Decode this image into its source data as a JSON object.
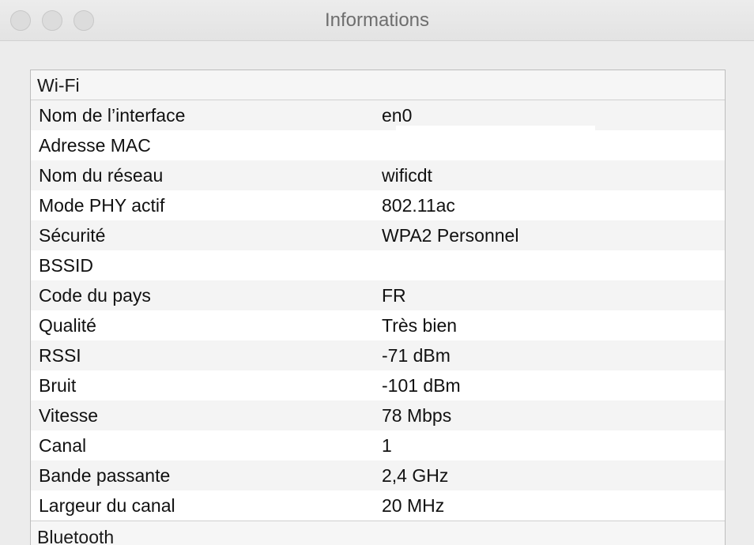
{
  "window": {
    "title": "Informations"
  },
  "wifi": {
    "header": "Wi-Fi",
    "rows": [
      {
        "label": "Nom de l’interface",
        "value": "en0"
      },
      {
        "label": "Adresse MAC",
        "value": ""
      },
      {
        "label": "Nom du réseau",
        "value": "wificdt"
      },
      {
        "label": "Mode PHY actif",
        "value": "802.11ac"
      },
      {
        "label": "Sécurité",
        "value": "WPA2 Personnel"
      },
      {
        "label": "BSSID",
        "value": ""
      },
      {
        "label": "Code du pays",
        "value": "FR"
      },
      {
        "label": "Qualité",
        "value": "Très bien"
      },
      {
        "label": "RSSI",
        "value": "-71 dBm"
      },
      {
        "label": "Bruit",
        "value": "-101 dBm"
      },
      {
        "label": "Vitesse",
        "value": "78 Mbps"
      },
      {
        "label": "Canal",
        "value": "1"
      },
      {
        "label": "Bande passante",
        "value": "2,4 GHz"
      },
      {
        "label": "Largeur du canal",
        "value": "20 MHz"
      }
    ]
  },
  "bluetooth": {
    "header": "Bluetooth"
  }
}
